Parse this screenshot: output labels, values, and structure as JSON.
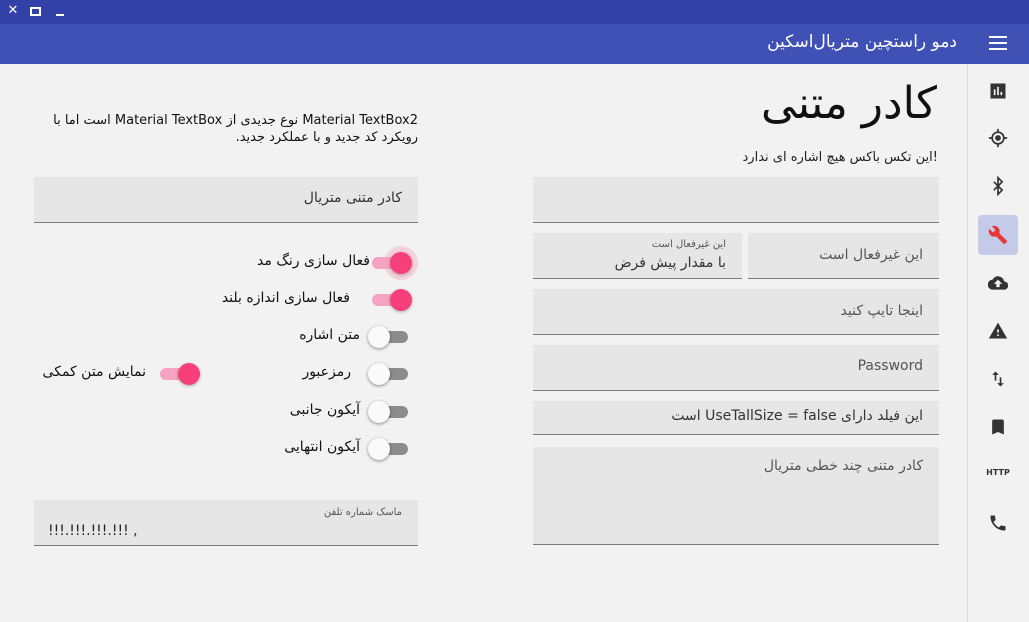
{
  "window": {
    "close_glyph": "✕",
    "maximize_glyph": "□",
    "minimize_glyph": "_"
  },
  "app_bar": {
    "title": "دمو راستچین متریال‌اسکین",
    "menu_icon": "hamburger-menu-icon"
  },
  "side_rail": {
    "items": [
      {
        "icon": "bar-chart-icon"
      },
      {
        "icon": "gps-target-icon"
      },
      {
        "icon": "bluetooth-icon"
      },
      {
        "icon": "wrench-icon",
        "active": true
      },
      {
        "icon": "cloud-upload-icon"
      },
      {
        "icon": "warning-icon"
      },
      {
        "icon": "swap-vertical-icon"
      },
      {
        "icon": "bookmark-icon"
      },
      {
        "icon": "http-icon",
        "text": "HTTP"
      },
      {
        "icon": "phone-icon"
      }
    ],
    "active_color": "#c5cae9"
  },
  "main": {
    "heading": "کادر متنی",
    "hint": "!این تکس باکس هیچ اشاره ای ندارد",
    "disabled_field": {
      "text": "این غیرفعال است"
    },
    "disabled_default_field": {
      "label": "این غیرفعال است",
      "value": "با مقدار پیش فرض"
    },
    "type_here_field": {
      "placeholder": "اینجا تایپ کنید"
    },
    "password_field": {
      "placeholder": "Password"
    },
    "short_field": {
      "text": "این فیلد دارای UseTallSize = false است"
    },
    "multiline_field": {
      "placeholder": "کادر متنی چند خطی متریال"
    }
  },
  "left_panel": {
    "description": "Material TextBox2 نوع جدیدی از Material TextBox است اما با رویکرد کد جدید و با عملکرد جدید.",
    "material_textbox": {
      "text": "کادر متنی متریال"
    },
    "toggles": {
      "color_mode": {
        "label": "فعال سازی رنگ مد",
        "on": true
      },
      "tall_size": {
        "label": "فعال سازی اندازه بلند",
        "on": true
      },
      "hint_text": {
        "label": "متن اشاره",
        "on": false
      },
      "password": {
        "label": "رمزعبور",
        "on": false
      },
      "helper_text": {
        "label": "نمایش متن کمکی",
        "on": true
      },
      "leading_icon": {
        "label": "آیکون جانبی",
        "on": false
      },
      "trailing_icon": {
        "label": "آیکون انتهایی",
        "on": false
      }
    },
    "phone_mask": {
      "label": "ماسک شماره تلفن",
      "value": "!!!.!!!.!!!.!!! ,"
    }
  },
  "colors": {
    "title_bar": "#3141a8",
    "app_bar": "#3f51b5",
    "accent": "#f7407a",
    "field_bg": "#e6e6e6"
  }
}
